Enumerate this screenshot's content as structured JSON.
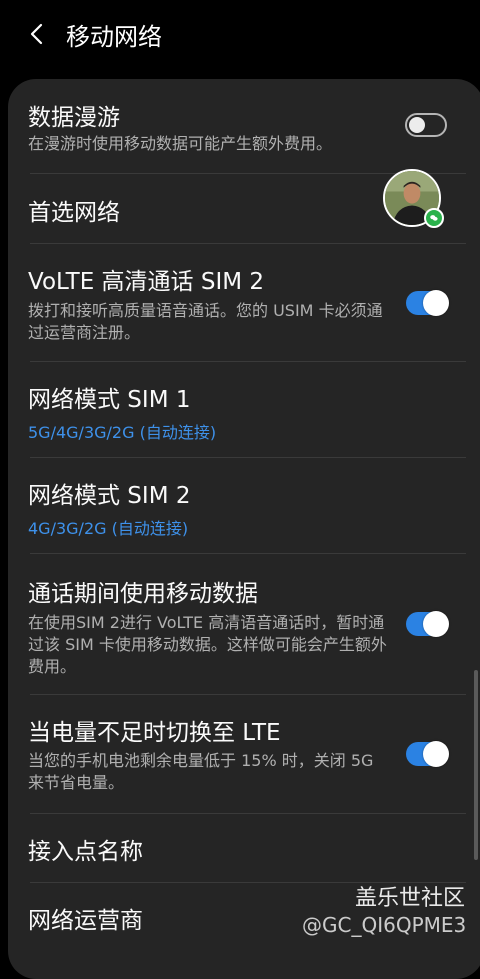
{
  "header": {
    "title": "移动网络"
  },
  "items": [
    {
      "label": "数据漫游",
      "desc": "在漫游时使用移动数据可能产生额外费用。",
      "toggle": "off"
    },
    {
      "label": "首选网络"
    },
    {
      "label": "VoLTE 高清通话 SIM 2",
      "desc": "拨打和接听高质量语音通话。您的 USIM 卡必须通过运营商注册。",
      "toggle": "on"
    },
    {
      "label": "网络模式 SIM 1",
      "sub": "5G/4G/3G/2G (自动连接)"
    },
    {
      "label": "网络模式 SIM 2",
      "sub": "4G/3G/2G (自动连接)"
    },
    {
      "label": "通话期间使用移动数据",
      "desc": "在使用SIM 2进行 VoLTE 高清语音通话时，暂时通过该 SIM 卡使用移动数据。这样做可能会产生额外费用。",
      "toggle": "on"
    },
    {
      "label": "当电量不足时切换至 LTE",
      "desc": "当您的手机电池剩余电量低于 15% 时，关闭 5G 来节省电量。",
      "toggle": "on"
    },
    {
      "label": "接入点名称"
    },
    {
      "label": "网络运营商"
    }
  ],
  "watermark": {
    "line1": "盖乐世社区",
    "line2": "@GC_QI6QPME3"
  },
  "colors": {
    "accent": "#2b82e3",
    "link": "#3e91ea",
    "card": "#252525"
  }
}
